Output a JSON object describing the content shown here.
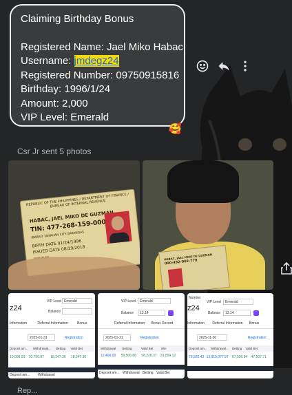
{
  "message": {
    "title": "Claiming Birthday Bonus",
    "registered_name": "Registered Name: Jael Miko Habac",
    "username_label": "Username: ",
    "username_value": "jmdegz24",
    "registered_number": "Registered Number: 09750915816",
    "birthday": "Birthday:  1996/1/24",
    "amount": "Amount: 2,000",
    "vip_level": "VIP Level: Emerald",
    "reaction": "🥰"
  },
  "actions": {
    "react_icon": "smile-icon",
    "reply_icon": "reply-icon",
    "more_icon": "more-vertical-icon"
  },
  "sender_caption": "Csr Jr sent 5 photos",
  "photo1": {
    "header": "REPUBLIC OF THE PHILIPPINES / DEPARTMENT OF FINANCE / BUREAU OF INTERNAL REVENUE",
    "name": "HABAC, JAEL MIKO DE GUZMAN",
    "tin": "TIN: 477-268-159-000",
    "address": "IBABAO TANAUAN CITY BATANGAS",
    "dob": "BIRTH DATE 01/24/1996",
    "issued": "ISSUED DATE 08/19/2018",
    "signature_label": "SIGNATURE"
  },
  "photo2": {
    "card_name": "HABAC, JAEL MIKO DE GUZMAN",
    "card_tin": "000-492-002-778"
  },
  "photo3": {
    "vip_label": "VIP Level",
    "vip_value": "Emerald",
    "balance_label": "Balance",
    "big_text": "z24",
    "tab1": "Information",
    "tab2": "Referral Information",
    "tab3": "Bonus",
    "date_value": "2025-01-31",
    "registration": "Registration",
    "col1": "Deposit am...",
    "col2": "Withdrawal...",
    "col3": "Betting",
    "col4": "Valid Bet",
    "v1": "10,000.00",
    "v2": "10,750.87",
    "v3": "18,247.36",
    "v4": "18,247.36",
    "foot1": "Deposit am...",
    "foot2": "Withdrawal"
  },
  "photo4": {
    "vip_label": "VIP Level",
    "vip_value": "Emerald",
    "balance_label": "Balance",
    "balance_value": "13.14",
    "tab1": "Referral Information",
    "tab2": "Bonus Record",
    "date_value": "2025-01-31",
    "registration": "Registration",
    "col1": "Withdrawal",
    "col2": "Betting",
    "col3": "Valid Bet",
    "col4": "Win",
    "v1": "12,400.00",
    "v2": "59,506.88",
    "v3": "56,226.37",
    "v4": "31,654.12",
    "foot1": "Deposit am...",
    "foot2": "Withdrawal",
    "foot3": "Betting",
    "foot4": "Valid Bet"
  },
  "photo5": {
    "top": "Number",
    "vip_label": "VIP Level",
    "vip_value": "Emerald",
    "balance_label": "Balance",
    "balance_value": "13.14",
    "big_text": "z24",
    "tab1": "Information",
    "tab2": "Referral Information",
    "tab3": "Bonus",
    "date_value": "2025-11-30",
    "registration": "Registration",
    "col1": "Deposit am...",
    "col2": "Withdrawal...",
    "col3": "Betting",
    "col4": "Valid Bet",
    "v1": "79,592.43",
    "v2": "13,915,077.97",
    "v3": "67,556.84",
    "v4": "47,507.71"
  },
  "share_icon": "share-icon",
  "bottom_text": "Rep..."
}
